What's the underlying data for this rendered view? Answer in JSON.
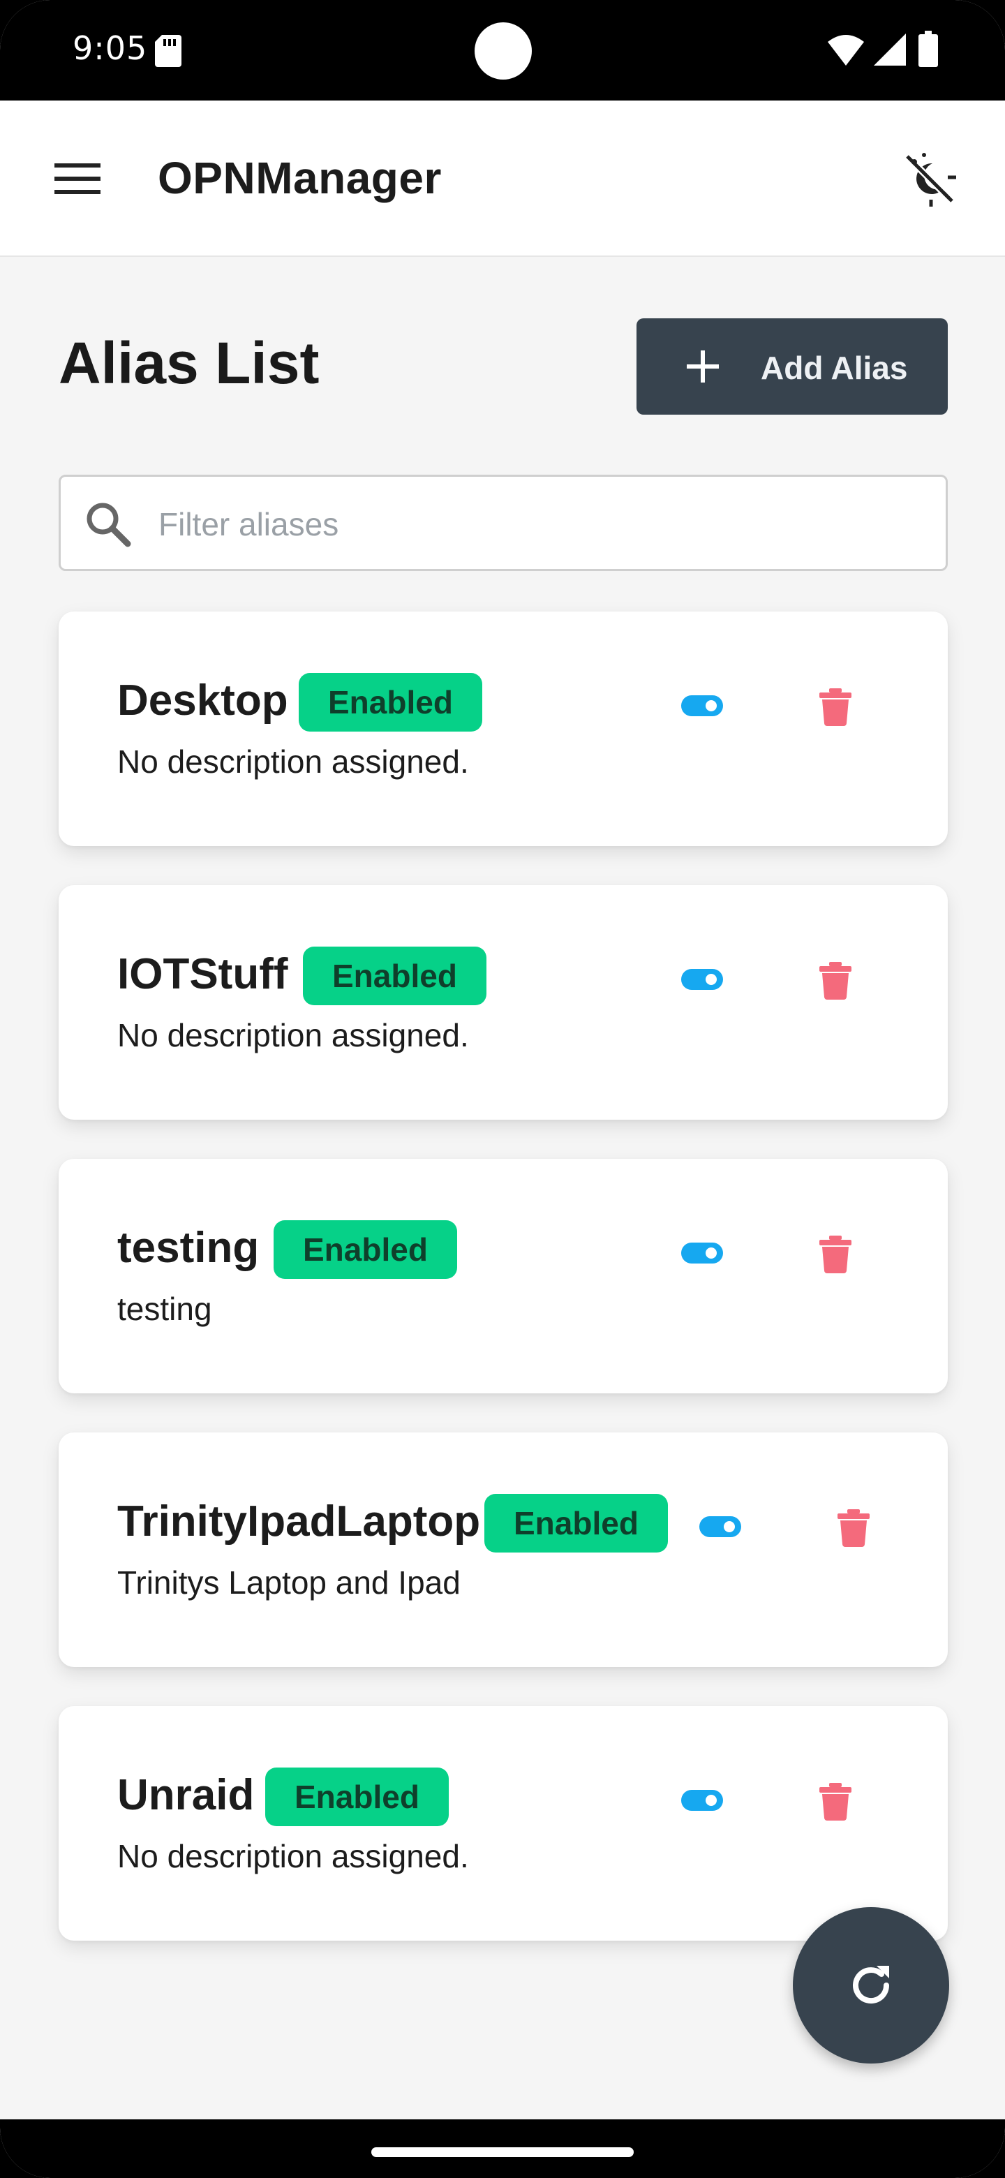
{
  "status_bar": {
    "time": "9:05"
  },
  "app_bar": {
    "title": "OPNManager"
  },
  "page": {
    "title": "Alias List",
    "add_button_label": "Add Alias"
  },
  "search": {
    "placeholder": "Filter aliases",
    "value": ""
  },
  "aliases": [
    {
      "name": "Desktop",
      "status": "Enabled",
      "description": "No description assigned.",
      "enabled": true
    },
    {
      "name": "IOTStuff",
      "status": "Enabled",
      "description": "No description assigned.",
      "enabled": true
    },
    {
      "name": "testing",
      "status": "Enabled",
      "description": "testing",
      "enabled": true
    },
    {
      "name": "TrinityIpadLaptop",
      "status": "Enabled",
      "description": "Trinitys Laptop and Ipad",
      "enabled": true
    },
    {
      "name": "Unraid",
      "status": "Enabled",
      "description": "No description assigned.",
      "enabled": true
    }
  ],
  "colors": {
    "badge": "#06d188",
    "toggle": "#16a8f0",
    "delete": "#f46a7c",
    "primary": "#37434e"
  },
  "icons": {
    "menu": "menu-icon",
    "theme": "theme-toggle-icon",
    "add": "plus-icon",
    "search": "search-icon",
    "toggle": "toggle-switch-icon",
    "delete": "trash-icon",
    "refresh": "refresh-icon"
  }
}
